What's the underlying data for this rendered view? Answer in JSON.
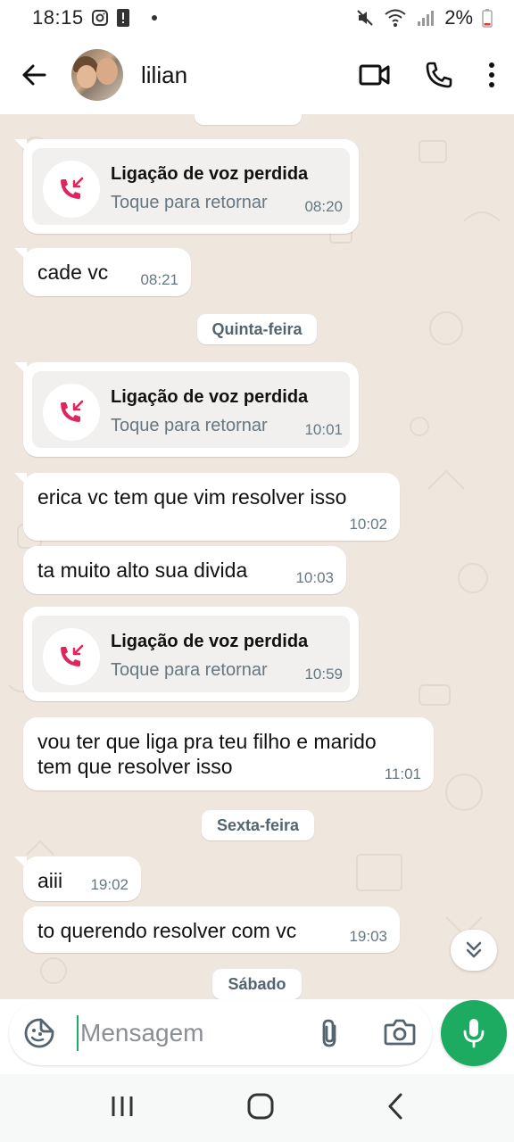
{
  "status_bar": {
    "time": "18:15",
    "battery": "2%"
  },
  "header": {
    "contact_name": "lilian"
  },
  "colors": {
    "accent": "#1daa61",
    "missed_call": "#e0245e",
    "chat_bg": "#efe7de"
  },
  "messages": [
    {
      "type": "call",
      "title": "Ligação de voz perdida",
      "subtitle": "Toque para retornar",
      "time": "08:20"
    },
    {
      "type": "text",
      "text": "cade vc",
      "time": "08:21"
    },
    {
      "type": "date",
      "text": "Quinta-feira"
    },
    {
      "type": "call",
      "title": "Ligação de voz perdida",
      "subtitle": "Toque para retornar",
      "time": "10:01"
    },
    {
      "type": "text",
      "text": "erica vc tem que vim resolver isso",
      "time": "10:02"
    },
    {
      "type": "text",
      "text": "ta muito alto sua divida",
      "time": "10:03"
    },
    {
      "type": "call",
      "title": "Ligação de voz perdida",
      "subtitle": "Toque para retornar",
      "time": "10:59"
    },
    {
      "type": "text",
      "text": "vou ter que liga pra teu filho e marido",
      "text2": "tem que resolver isso",
      "time": "11:01"
    },
    {
      "type": "date",
      "text": "Sexta-feira"
    },
    {
      "type": "text",
      "text": "aiii",
      "time": "19:02"
    },
    {
      "type": "text",
      "text": "to querendo resolver com vc",
      "time": "19:03"
    },
    {
      "type": "date",
      "text": "Sábado"
    }
  ],
  "composer": {
    "placeholder": "Mensagem"
  },
  "icons": {
    "back": "arrow-left-icon",
    "video": "video-camera-icon",
    "call": "phone-icon",
    "menu": "more-vert-icon",
    "emoji": "sticker-icon",
    "attach": "paperclip-icon",
    "camera": "camera-icon",
    "mic": "microphone-icon",
    "scroll": "double-chevron-down-icon"
  }
}
